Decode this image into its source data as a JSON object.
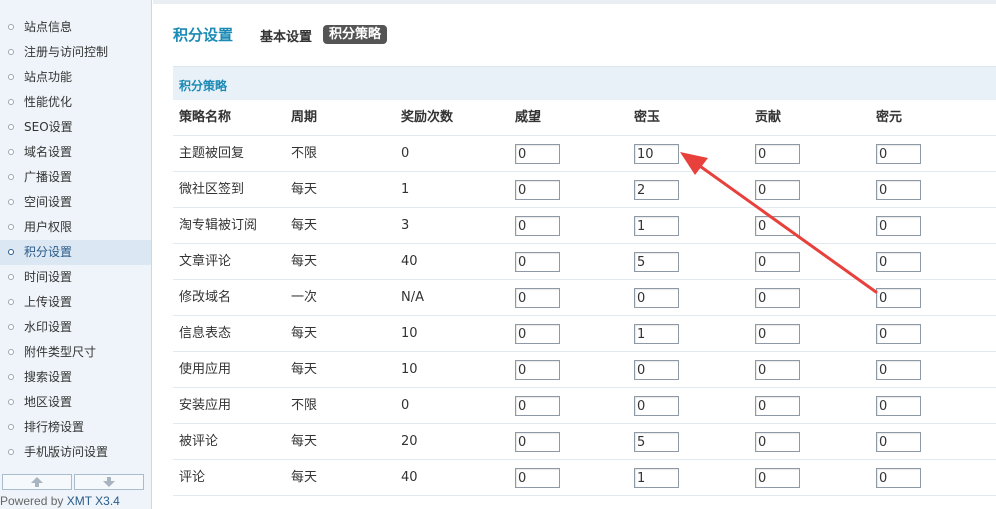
{
  "sidebar": {
    "items": [
      {
        "label": "站点信息"
      },
      {
        "label": "注册与访问控制"
      },
      {
        "label": "站点功能"
      },
      {
        "label": "性能优化"
      },
      {
        "label": "SEO设置"
      },
      {
        "label": "域名设置"
      },
      {
        "label": "广播设置"
      },
      {
        "label": "空间设置"
      },
      {
        "label": "用户权限"
      },
      {
        "label": "积分设置"
      },
      {
        "label": "时间设置"
      },
      {
        "label": "上传设置"
      },
      {
        "label": "水印设置"
      },
      {
        "label": "附件类型尺寸"
      },
      {
        "label": "搜索设置"
      },
      {
        "label": "地区设置"
      },
      {
        "label": "排行榜设置"
      },
      {
        "label": "手机版访问设置"
      }
    ],
    "active_index": 9,
    "scroll_up_icon": "arrow-up-icon",
    "scroll_down_icon": "arrow-down-icon",
    "powered_prefix": "Powered by ",
    "powered_version": "XMT X3.4"
  },
  "header": {
    "title": "积分设置",
    "tab_basic": "基本设置",
    "tab_active": "积分策略"
  },
  "section": {
    "title": "积分策略"
  },
  "table": {
    "columns": [
      "策略名称",
      "周期",
      "奖励次数",
      "威望",
      "密玉",
      "贡献",
      "密元"
    ],
    "rows": [
      {
        "name": "主题被回复",
        "period": "不限",
        "count": "0",
        "v1": "0",
        "v2": "10",
        "v3": "0",
        "v4": "0"
      },
      {
        "name": "微社区签到",
        "period": "每天",
        "count": "1",
        "v1": "0",
        "v2": "2",
        "v3": "0",
        "v4": "0"
      },
      {
        "name": "淘专辑被订阅",
        "period": "每天",
        "count": "3",
        "v1": "0",
        "v2": "1",
        "v3": "0",
        "v4": "0"
      },
      {
        "name": "文章评论",
        "period": "每天",
        "count": "40",
        "v1": "0",
        "v2": "5",
        "v3": "0",
        "v4": "0"
      },
      {
        "name": "修改域名",
        "period": "一次",
        "count": "N/A",
        "v1": "0",
        "v2": "0",
        "v3": "0",
        "v4": "0"
      },
      {
        "name": "信息表态",
        "period": "每天",
        "count": "10",
        "v1": "0",
        "v2": "1",
        "v3": "0",
        "v4": "0"
      },
      {
        "name": "使用应用",
        "period": "每天",
        "count": "10",
        "v1": "0",
        "v2": "0",
        "v3": "0",
        "v4": "0"
      },
      {
        "name": "安装应用",
        "period": "不限",
        "count": "0",
        "v1": "0",
        "v2": "0",
        "v3": "0",
        "v4": "0"
      },
      {
        "name": "被评论",
        "period": "每天",
        "count": "20",
        "v1": "0",
        "v2": "5",
        "v3": "0",
        "v4": "0"
      },
      {
        "name": "评论",
        "period": "每天",
        "count": "40",
        "v1": "0",
        "v2": "1",
        "v3": "0",
        "v4": "0"
      }
    ]
  },
  "colors": {
    "accent": "#1b8ab5",
    "annotation_arrow": "#e8413c"
  }
}
